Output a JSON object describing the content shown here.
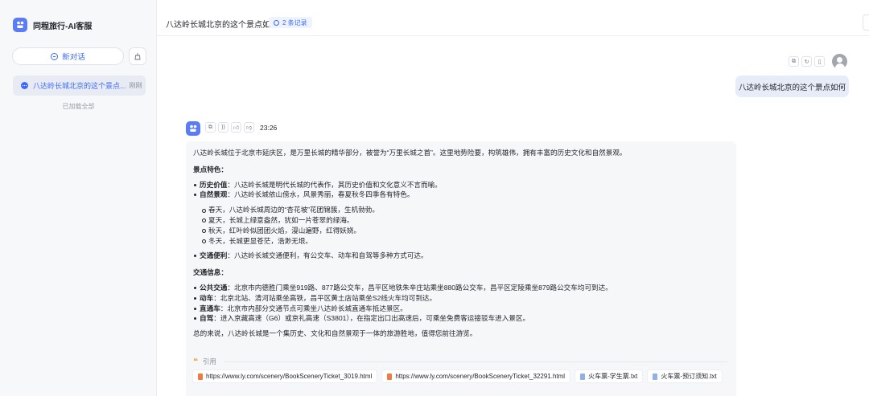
{
  "app": {
    "brand_name": "同程旅行-AI客服"
  },
  "sidebar": {
    "new_chat_label": "新对话",
    "conversations": [
      {
        "title": "八达岭长城北京的这个景点...",
        "time": "刚刚"
      }
    ],
    "loaded_all": "已加载全部"
  },
  "header": {
    "title": "八达岭长城北京的这个景点如何",
    "records_badge": "2 条记录"
  },
  "user_message": {
    "text": "八达岭长城北京的这个景点如何"
  },
  "bot_message": {
    "time": "23:26",
    "intro": "八达岭长城位于北京市延庆区，是万里长城的精华部分，被誉为“万里长城之首”。这里地势险要，构筑雄伟，拥有丰富的历史文化和自然景观。",
    "section1_title": "景点特色",
    "features": [
      {
        "label": "历史价值",
        "text": "：八达岭长城是明代长城的代表作，其历史价值和文化意义不言而喻。"
      },
      {
        "label": "自然景观",
        "text": "：八达岭长城依山傍水，风景秀丽，春夏秋冬四季各有特色。"
      }
    ],
    "seasons": [
      "春天，八达岭长城周边的“杏花坡”花团锦簇，生机勃勃。",
      "夏天，长城上绿意盎然，犹如一片苍翠的绿海。",
      "秋天，红叶岭似团团火焰，漫山遍野，红得妖娆。",
      "冬天，长城更显苍茫，浩渺无垠。"
    ],
    "transport_feature": {
      "label": "交通便利",
      "text": "：八达岭长城交通便利，有公交车、动车和自驾等多种方式可达。"
    },
    "section2_title": "交通信息",
    "transport": [
      {
        "label": "公共交通",
        "text": "：北京市内德胜门乘坐919路、877路公交车，昌平区地铁朱辛庄站乘坐880路公交车，昌平区定陵乘坐879路公交车均可到达。"
      },
      {
        "label": "动车",
        "text": "：北京北站、清河站乘坐高铁，昌平区黄土店站乘坐S2线火车均可到达。"
      },
      {
        "label": "直通车",
        "text": "：北京市内部分交通节点可乘坐八达岭长城直通车抵达景区。"
      },
      {
        "label": "自驾",
        "text": "：进入京藏高速（G6）或京礼高速（S3801），在指定出口出高速后，可乘坐免费客运接驳车进入景区。"
      }
    ],
    "summary": "总的来说，八达岭长城是一个集历史、文化和自然景观于一体的旅游胜地，值得您前往游览。",
    "citation_label": "引用",
    "citations": [
      {
        "text": "https://www.ly.com/scenery/BookSceneryTicket_3019.html",
        "kind": "web"
      },
      {
        "text": "https://www.ly.com/scenery/BookSceneryTicket_32291.html",
        "kind": "web"
      },
      {
        "text": "火车票-学生票.txt",
        "kind": "txt"
      },
      {
        "text": "火车票-预订须知.txt",
        "kind": "txt"
      }
    ]
  },
  "colors": {
    "accent": "#3c6cf6",
    "logo": "#5b7cf7",
    "user_bubble": "#e7ecf9"
  }
}
